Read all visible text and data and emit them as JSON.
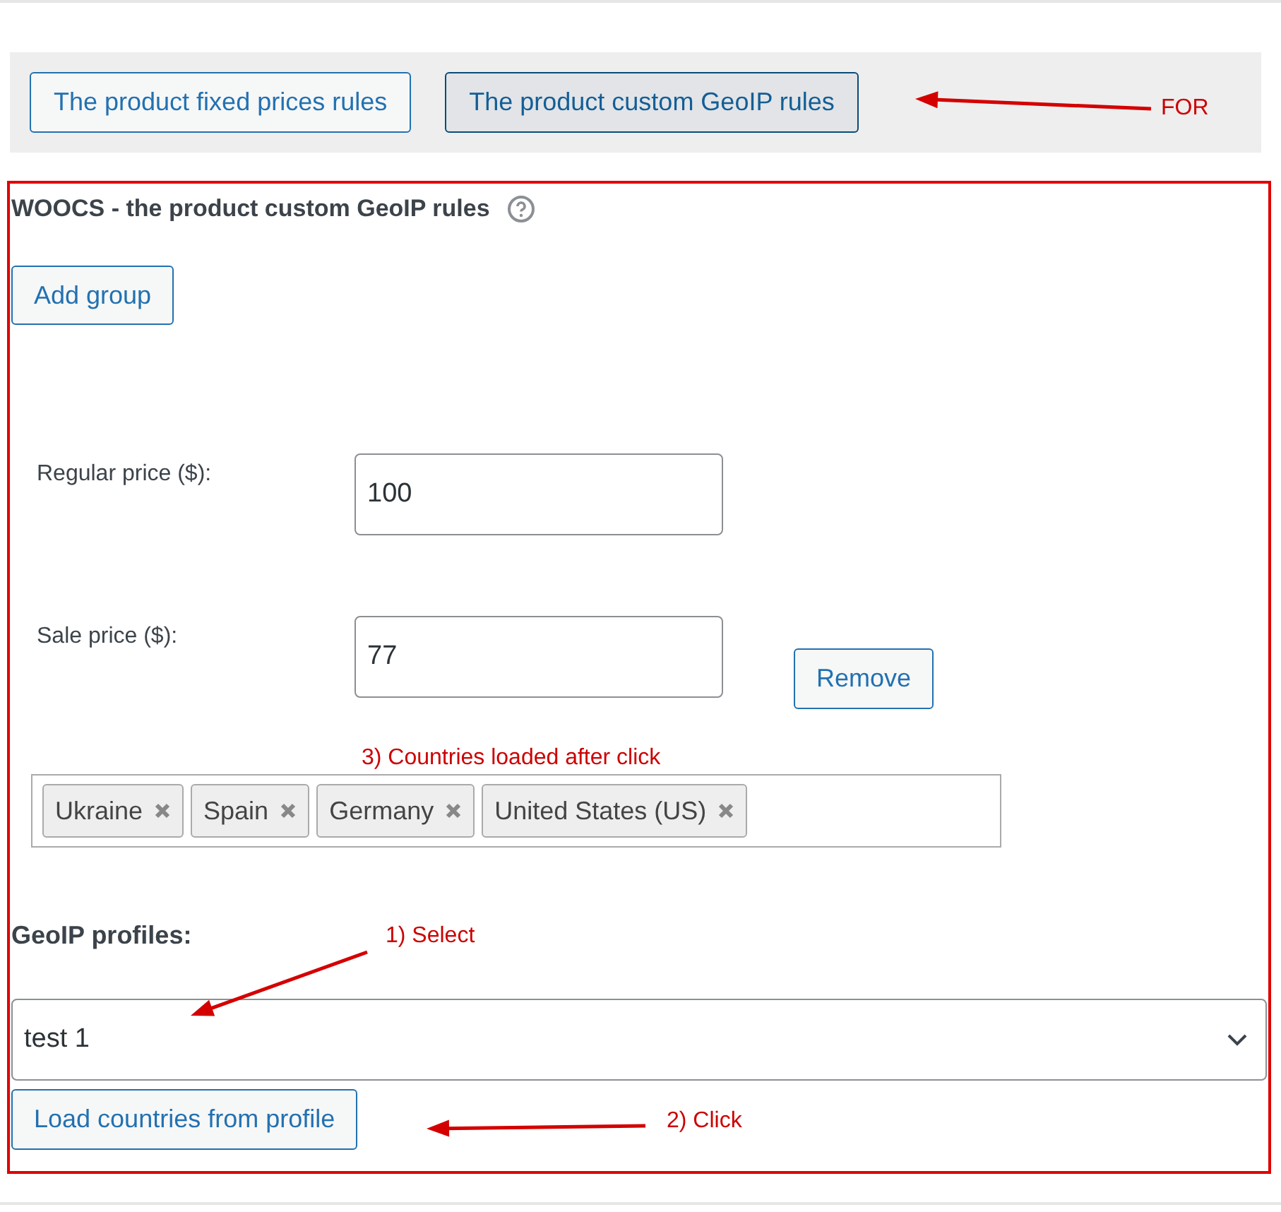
{
  "tabs": [
    {
      "label": "The product fixed prices rules",
      "selected": false
    },
    {
      "label": "The product custom GeoIP rules",
      "selected": true
    }
  ],
  "section": {
    "title": "WOOCS - the product custom GeoIP rules",
    "add_button": "Add group",
    "fields": [
      {
        "label": "Regular price ($):",
        "value": "100"
      },
      {
        "label": "Sale price ($):",
        "value": "77"
      }
    ],
    "remove_button": "Remove",
    "countries": [
      {
        "name": "Ukraine"
      },
      {
        "name": "Spain"
      },
      {
        "name": "Germany"
      },
      {
        "name": "United States (US)"
      }
    ],
    "profiles_label": "GeoIP profiles:",
    "profile_select": "test 1",
    "load_button": "Load countries from profile"
  },
  "annotations": [
    {
      "text": "FOR"
    },
    {
      "text": "3) Countries loaded after click"
    },
    {
      "text": "1) Select"
    },
    {
      "text": "2) Click"
    }
  ]
}
